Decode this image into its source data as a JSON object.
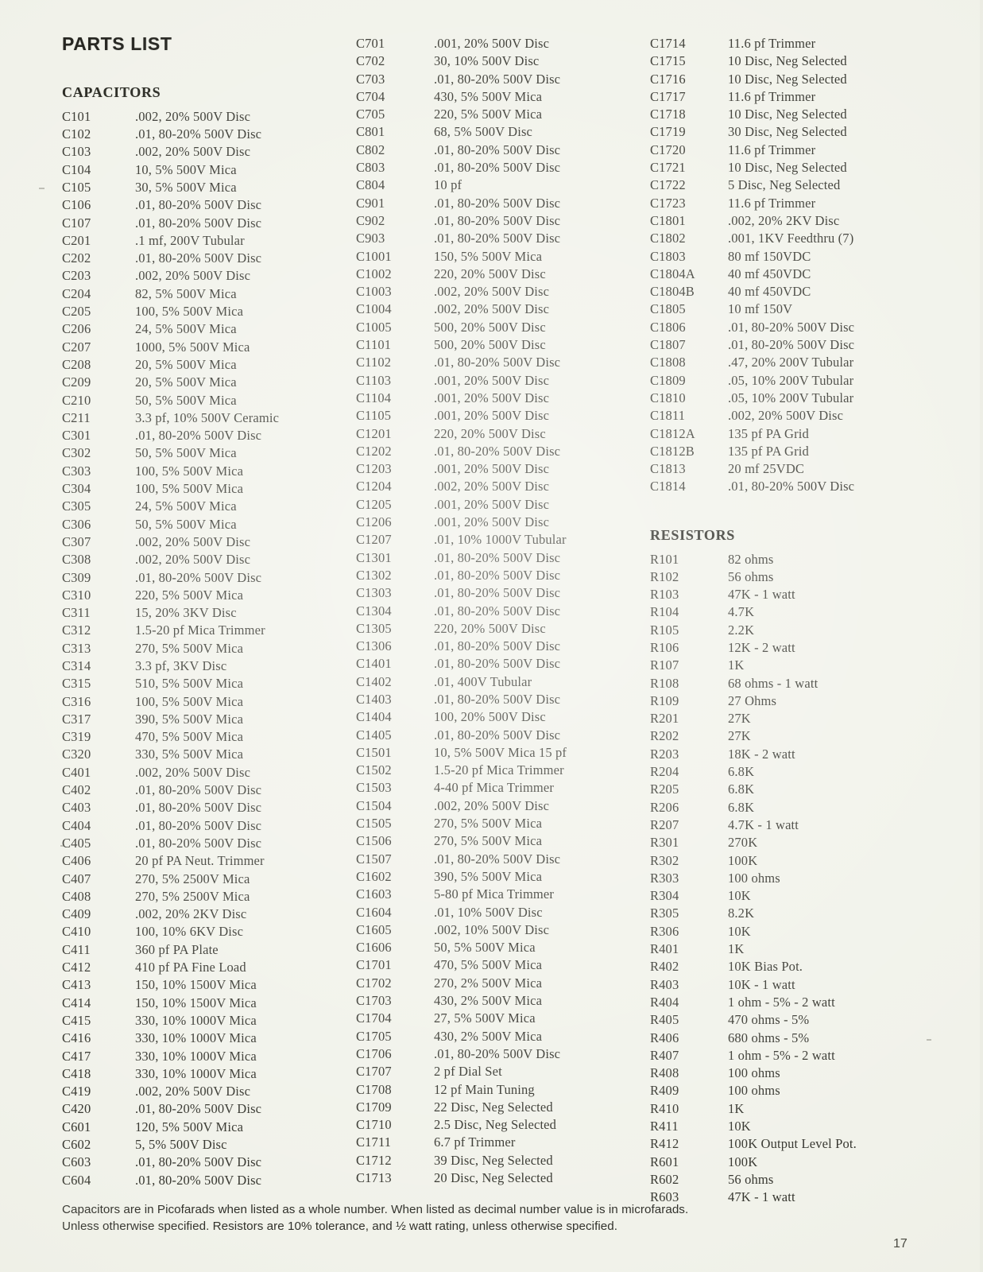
{
  "document": {
    "title": "PARTS LIST",
    "page_number": "17"
  },
  "sections": {
    "capacitors_heading": "CAPACITORS",
    "resistors_heading": "RESISTORS"
  },
  "footnote": {
    "line1": "Capacitors are in Picofarads when listed as a whole number. When listed as decimal number value is in microfarads.",
    "line2": "Unless otherwise specified. Resistors are 10% tolerance, and ½ watt rating, unless otherwise specified."
  },
  "column1": [
    {
      "ref": "C101",
      "value": ".002, 20% 500V Disc"
    },
    {
      "ref": "C102",
      "value": ".01, 80-20% 500V Disc"
    },
    {
      "ref": "C103",
      "value": ".002, 20% 500V Disc"
    },
    {
      "ref": "C104",
      "value": "10, 5% 500V Mica"
    },
    {
      "ref": "C105",
      "value": "30, 5% 500V Mica"
    },
    {
      "ref": "C106",
      "value": ".01, 80-20% 500V Disc"
    },
    {
      "ref": "C107",
      "value": ".01, 80-20% 500V Disc"
    },
    {
      "ref": "C201",
      "value": ".1 mf, 200V Tubular"
    },
    {
      "ref": "C202",
      "value": ".01, 80-20% 500V Disc"
    },
    {
      "ref": "C203",
      "value": ".002, 20% 500V Disc"
    },
    {
      "ref": "C204",
      "value": "82, 5% 500V Mica"
    },
    {
      "ref": "C205",
      "value": "100, 5% 500V Mica"
    },
    {
      "ref": "C206",
      "value": "24, 5% 500V Mica"
    },
    {
      "ref": "C207",
      "value": "1000, 5% 500V Mica"
    },
    {
      "ref": "C208",
      "value": "20, 5% 500V Mica"
    },
    {
      "ref": "C209",
      "value": "20, 5% 500V Mica"
    },
    {
      "ref": "C210",
      "value": "50, 5% 500V Mica"
    },
    {
      "ref": "C211",
      "value": "3.3 pf, 10% 500V Ceramic"
    },
    {
      "ref": "C301",
      "value": ".01, 80-20% 500V Disc"
    },
    {
      "ref": "C302",
      "value": "50, 5% 500V Mica"
    },
    {
      "ref": "C303",
      "value": "100, 5% 500V Mica"
    },
    {
      "ref": "C304",
      "value": "100, 5% 500V Mica"
    },
    {
      "ref": "C305",
      "value": "24, 5% 500V Mica"
    },
    {
      "ref": "C306",
      "value": "50, 5% 500V Mica"
    },
    {
      "ref": "C307",
      "value": ".002, 20% 500V Disc"
    },
    {
      "ref": "C308",
      "value": ".002, 20% 500V Disc"
    },
    {
      "ref": "C309",
      "value": ".01, 80-20% 500V Disc"
    },
    {
      "ref": "C310",
      "value": "220, 5% 500V Mica"
    },
    {
      "ref": "C311",
      "value": "15, 20% 3KV Disc"
    },
    {
      "ref": "C312",
      "value": "1.5-20 pf Mica Trimmer"
    },
    {
      "ref": "C313",
      "value": "270, 5% 500V Mica"
    },
    {
      "ref": "C314",
      "value": "3.3 pf, 3KV Disc"
    },
    {
      "ref": "C315",
      "value": "510, 5% 500V Mica"
    },
    {
      "ref": "C316",
      "value": "100, 5% 500V Mica"
    },
    {
      "ref": "C317",
      "value": "390, 5% 500V Mica"
    },
    {
      "ref": "C319",
      "value": "470, 5% 500V Mica"
    },
    {
      "ref": "C320",
      "value": "330, 5% 500V Mica"
    },
    {
      "ref": "C401",
      "value": ".002, 20% 500V Disc"
    },
    {
      "ref": "C402",
      "value": ".01, 80-20% 500V Disc"
    },
    {
      "ref": "C403",
      "value": ".01, 80-20% 500V Disc"
    },
    {
      "ref": "C404",
      "value": ".01, 80-20% 500V Disc"
    },
    {
      "ref": "C405",
      "value": ".01, 80-20% 500V Disc"
    },
    {
      "ref": "C406",
      "value": "20 pf PA Neut. Trimmer"
    },
    {
      "ref": "C407",
      "value": "270, 5% 2500V Mica"
    },
    {
      "ref": "C408",
      "value": "270, 5% 2500V Mica"
    },
    {
      "ref": "C409",
      "value": ".002, 20% 2KV Disc"
    },
    {
      "ref": "C410",
      "value": "100, 10% 6KV Disc"
    },
    {
      "ref": "C411",
      "value": "360 pf PA Plate"
    },
    {
      "ref": "C412",
      "value": "410 pf PA Fine Load"
    },
    {
      "ref": "C413",
      "value": "150, 10% 1500V Mica"
    },
    {
      "ref": "C414",
      "value": "150, 10% 1500V Mica"
    },
    {
      "ref": "C415",
      "value": "330, 10% 1000V Mica"
    },
    {
      "ref": "C416",
      "value": "330, 10% 1000V Mica"
    },
    {
      "ref": "C417",
      "value": "330, 10% 1000V Mica"
    },
    {
      "ref": "C418",
      "value": "330, 10% 1000V Mica"
    },
    {
      "ref": "C419",
      "value": ".002, 20% 500V Disc"
    },
    {
      "ref": "C420",
      "value": ".01, 80-20% 500V Disc"
    },
    {
      "ref": "C601",
      "value": "120, 5% 500V Mica"
    },
    {
      "ref": "C602",
      "value": "5, 5% 500V Disc"
    },
    {
      "ref": "C603",
      "value": ".01, 80-20% 500V Disc"
    },
    {
      "ref": "C604",
      "value": ".01, 80-20% 500V Disc"
    }
  ],
  "column2": [
    {
      "ref": "C701",
      "value": ".001, 20% 500V Disc"
    },
    {
      "ref": "C702",
      "value": "30, 10% 500V Disc"
    },
    {
      "ref": "C703",
      "value": ".01, 80-20% 500V Disc"
    },
    {
      "ref": "C704",
      "value": "430, 5% 500V Mica"
    },
    {
      "ref": "C705",
      "value": "220, 5% 500V Mica"
    },
    {
      "ref": "C801",
      "value": "68, 5% 500V Disc"
    },
    {
      "ref": "C802",
      "value": ".01, 80-20% 500V Disc"
    },
    {
      "ref": "C803",
      "value": ".01, 80-20% 500V Disc"
    },
    {
      "ref": "C804",
      "value": "10 pf"
    },
    {
      "ref": "C901",
      "value": ".01, 80-20% 500V Disc"
    },
    {
      "ref": "C902",
      "value": ".01, 80-20% 500V Disc"
    },
    {
      "ref": "C903",
      "value": ".01, 80-20% 500V Disc"
    },
    {
      "ref": "C1001",
      "value": "150, 5% 500V Mica"
    },
    {
      "ref": "C1002",
      "value": "220, 20% 500V Disc"
    },
    {
      "ref": "C1003",
      "value": ".002, 20% 500V Disc"
    },
    {
      "ref": "C1004",
      "value": ".002, 20% 500V Disc"
    },
    {
      "ref": "C1005",
      "value": "500, 20% 500V Disc"
    },
    {
      "ref": "C1101",
      "value": "500, 20% 500V Disc"
    },
    {
      "ref": "C1102",
      "value": ".01, 80-20% 500V Disc"
    },
    {
      "ref": "C1103",
      "value": ".001, 20% 500V Disc"
    },
    {
      "ref": "C1104",
      "value": ".001, 20% 500V Disc"
    },
    {
      "ref": "C1105",
      "value": ".001, 20% 500V Disc"
    },
    {
      "ref": "C1201",
      "value": "220, 20% 500V Disc"
    },
    {
      "ref": "C1202",
      "value": ".01, 80-20% 500V Disc"
    },
    {
      "ref": "C1203",
      "value": ".001, 20% 500V Disc"
    },
    {
      "ref": "C1204",
      "value": ".002, 20% 500V Disc"
    },
    {
      "ref": "C1205",
      "value": ".001, 20% 500V Disc"
    },
    {
      "ref": "C1206",
      "value": ".001, 20% 500V Disc"
    },
    {
      "ref": "C1207",
      "value": ".01, 10% 1000V Tubular"
    },
    {
      "ref": "C1301",
      "value": ".01, 80-20% 500V Disc"
    },
    {
      "ref": "C1302",
      "value": ".01, 80-20% 500V Disc"
    },
    {
      "ref": "C1303",
      "value": ".01, 80-20% 500V Disc"
    },
    {
      "ref": "C1304",
      "value": ".01, 80-20% 500V Disc"
    },
    {
      "ref": "C1305",
      "value": "220, 20% 500V Disc"
    },
    {
      "ref": "C1306",
      "value": ".01, 80-20% 500V Disc"
    },
    {
      "ref": "C1401",
      "value": ".01, 80-20% 500V Disc"
    },
    {
      "ref": "C1402",
      "value": ".01, 400V Tubular"
    },
    {
      "ref": "C1403",
      "value": ".01, 80-20% 500V Disc"
    },
    {
      "ref": "C1404",
      "value": "100, 20% 500V Disc"
    },
    {
      "ref": "C1405",
      "value": ".01, 80-20% 500V Disc"
    },
    {
      "ref": "C1501",
      "value": "10, 5% 500V Mica 15 pf"
    },
    {
      "ref": "C1502",
      "value": "1.5-20 pf Mica Trimmer"
    },
    {
      "ref": "C1503",
      "value": "4-40 pf Mica Trimmer"
    },
    {
      "ref": "C1504",
      "value": ".002, 20% 500V Disc"
    },
    {
      "ref": "C1505",
      "value": "270, 5% 500V Mica"
    },
    {
      "ref": "C1506",
      "value": "270, 5% 500V Mica"
    },
    {
      "ref": "C1507",
      "value": ".01, 80-20% 500V Disc"
    },
    {
      "ref": "C1602",
      "value": "390, 5% 500V Mica"
    },
    {
      "ref": "C1603",
      "value": "5-80 pf Mica Trimmer"
    },
    {
      "ref": "C1604",
      "value": ".01, 10% 500V Disc"
    },
    {
      "ref": "C1605",
      "value": ".002, 10% 500V Disc"
    },
    {
      "ref": "C1606",
      "value": "50, 5% 500V Mica"
    },
    {
      "ref": "C1701",
      "value": "470, 5% 500V Mica"
    },
    {
      "ref": "C1702",
      "value": "270, 2% 500V Mica"
    },
    {
      "ref": "C1703",
      "value": "430, 2% 500V Mica"
    },
    {
      "ref": "C1704",
      "value": "27, 5% 500V Mica"
    },
    {
      "ref": "C1705",
      "value": "430, 2% 500V Mica"
    },
    {
      "ref": "C1706",
      "value": ".01, 80-20% 500V Disc"
    },
    {
      "ref": "C1707",
      "value": "2 pf Dial Set"
    },
    {
      "ref": "C1708",
      "value": "12 pf Main Tuning"
    },
    {
      "ref": "C1709",
      "value": "22 Disc, Neg Selected"
    },
    {
      "ref": "C1710",
      "value": "2.5 Disc, Neg Selected"
    },
    {
      "ref": "C1711",
      "value": "6.7 pf Trimmer"
    },
    {
      "ref": "C1712",
      "value": "39 Disc, Neg Selected"
    },
    {
      "ref": "C1713",
      "value": "20 Disc, Neg Selected"
    }
  ],
  "column3_capacitors": [
    {
      "ref": "C1714",
      "value": "11.6 pf Trimmer"
    },
    {
      "ref": "C1715",
      "value": "10 Disc, Neg Selected"
    },
    {
      "ref": "C1716",
      "value": "10 Disc, Neg Selected"
    },
    {
      "ref": "C1717",
      "value": "11.6 pf Trimmer"
    },
    {
      "ref": "C1718",
      "value": "10 Disc, Neg Selected"
    },
    {
      "ref": "C1719",
      "value": "30 Disc, Neg Selected"
    },
    {
      "ref": "C1720",
      "value": "11.6 pf Trimmer"
    },
    {
      "ref": "C1721",
      "value": "10 Disc, Neg Selected"
    },
    {
      "ref": "C1722",
      "value": "5 Disc, Neg Selected"
    },
    {
      "ref": "C1723",
      "value": "11.6 pf Trimmer"
    },
    {
      "ref": "C1801",
      "value": ".002, 20% 2KV Disc"
    },
    {
      "ref": "C1802",
      "value": ".001, 1KV Feedthru (7)"
    },
    {
      "ref": "C1803",
      "value": "80 mf 150VDC"
    },
    {
      "ref": "C1804A",
      "value": "40 mf 450VDC"
    },
    {
      "ref": "C1804B",
      "value": "40 mf 450VDC"
    },
    {
      "ref": "C1805",
      "value": "10 mf 150V"
    },
    {
      "ref": "C1806",
      "value": ".01, 80-20% 500V Disc"
    },
    {
      "ref": "C1807",
      "value": ".01, 80-20% 500V Disc"
    },
    {
      "ref": "C1808",
      "value": ".47, 20% 200V Tubular"
    },
    {
      "ref": "C1809",
      "value": ".05, 10% 200V Tubular"
    },
    {
      "ref": "C1810",
      "value": ".05, 10% 200V Tubular"
    },
    {
      "ref": "C1811",
      "value": ".002, 20% 500V Disc"
    },
    {
      "ref": "C1812A",
      "value": "135 pf PA Grid"
    },
    {
      "ref": "C1812B",
      "value": "135 pf PA Grid"
    },
    {
      "ref": "C1813",
      "value": "20 mf 25VDC"
    },
    {
      "ref": "C1814",
      "value": ".01, 80-20% 500V Disc"
    }
  ],
  "column3_resistors": [
    {
      "ref": "R101",
      "value": "82 ohms"
    },
    {
      "ref": "R102",
      "value": "56 ohms"
    },
    {
      "ref": "R103",
      "value": "47K - 1 watt"
    },
    {
      "ref": "R104",
      "value": "4.7K"
    },
    {
      "ref": "R105",
      "value": "2.2K"
    },
    {
      "ref": "R106",
      "value": "12K - 2 watt"
    },
    {
      "ref": "R107",
      "value": "1K"
    },
    {
      "ref": "R108",
      "value": "68 ohms - 1 watt"
    },
    {
      "ref": "R109",
      "value": "27 Ohms"
    },
    {
      "ref": "R201",
      "value": "27K"
    },
    {
      "ref": "R202",
      "value": "27K"
    },
    {
      "ref": "R203",
      "value": "18K - 2 watt"
    },
    {
      "ref": "R204",
      "value": "6.8K"
    },
    {
      "ref": "R205",
      "value": "6.8K"
    },
    {
      "ref": "R206",
      "value": "6.8K"
    },
    {
      "ref": "R207",
      "value": "4.7K - 1 watt"
    },
    {
      "ref": "R301",
      "value": "270K"
    },
    {
      "ref": "R302",
      "value": "100K"
    },
    {
      "ref": "R303",
      "value": "100 ohms"
    },
    {
      "ref": "R304",
      "value": "10K"
    },
    {
      "ref": "R305",
      "value": "8.2K"
    },
    {
      "ref": "R306",
      "value": "10K"
    },
    {
      "ref": "R401",
      "value": "1K"
    },
    {
      "ref": "R402",
      "value": "10K Bias Pot."
    },
    {
      "ref": "R403",
      "value": "10K - 1 watt"
    },
    {
      "ref": "R404",
      "value": "1 ohm - 5% - 2 watt"
    },
    {
      "ref": "R405",
      "value": "470 ohms - 5%"
    },
    {
      "ref": "R406",
      "value": "680 ohms - 5%"
    },
    {
      "ref": "R407",
      "value": "1 ohm - 5% - 2 watt"
    },
    {
      "ref": "R408",
      "value": "100 ohms"
    },
    {
      "ref": "R409",
      "value": "100 ohms"
    },
    {
      "ref": "R410",
      "value": "1K"
    },
    {
      "ref": "R411",
      "value": "10K"
    },
    {
      "ref": "R412",
      "value": "100K Output Level Pot."
    },
    {
      "ref": "R601",
      "value": "100K"
    },
    {
      "ref": "R602",
      "value": "56 ohms"
    },
    {
      "ref": "R603",
      "value": "47K - 1 watt"
    }
  ]
}
